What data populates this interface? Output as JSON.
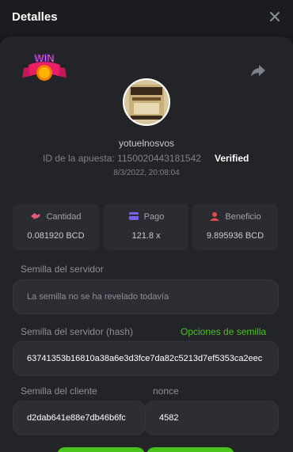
{
  "header": {
    "title": "Detalles",
    "close_icon": "close-icon"
  },
  "bet": {
    "username": "yotuelnosvos",
    "id_label": "ID de la apuesta: 1150020443181542",
    "verified": "Verified",
    "date": "8/3/2022, 20:08:04",
    "game_image": "se-busca-wanted-poster",
    "badge": "WIN"
  },
  "stats": [
    {
      "label": "Cantidad",
      "value": "0.081920 BCD",
      "icon": "coins-icon",
      "color": "#e05a7d"
    },
    {
      "label": "Pago",
      "value": "121.8 x",
      "icon": "card-icon",
      "color": "#7b5df0"
    },
    {
      "label": "Beneficio",
      "value": "9.895936 BCD",
      "icon": "profit-icon",
      "color": "#e04c4c"
    }
  ],
  "server_seed": {
    "label": "Semilla del servidor",
    "value": "La semilla no se ha revelado todavía"
  },
  "server_hash": {
    "label": "Semilla del servidor (hash)",
    "link": "Opciones de semilla",
    "value": "63741353b16810a38a6e3d3fce7da82c5213d7ef5353ca2eec"
  },
  "client_seed": {
    "label": "Semilla del cliente",
    "value": "d2dab641e88e7db46b6fc"
  },
  "nonce": {
    "label": "nonce",
    "value": "4582"
  },
  "colors": {
    "accent": "#4ac31c",
    "panel": "#232428",
    "card": "#2b2c31"
  }
}
